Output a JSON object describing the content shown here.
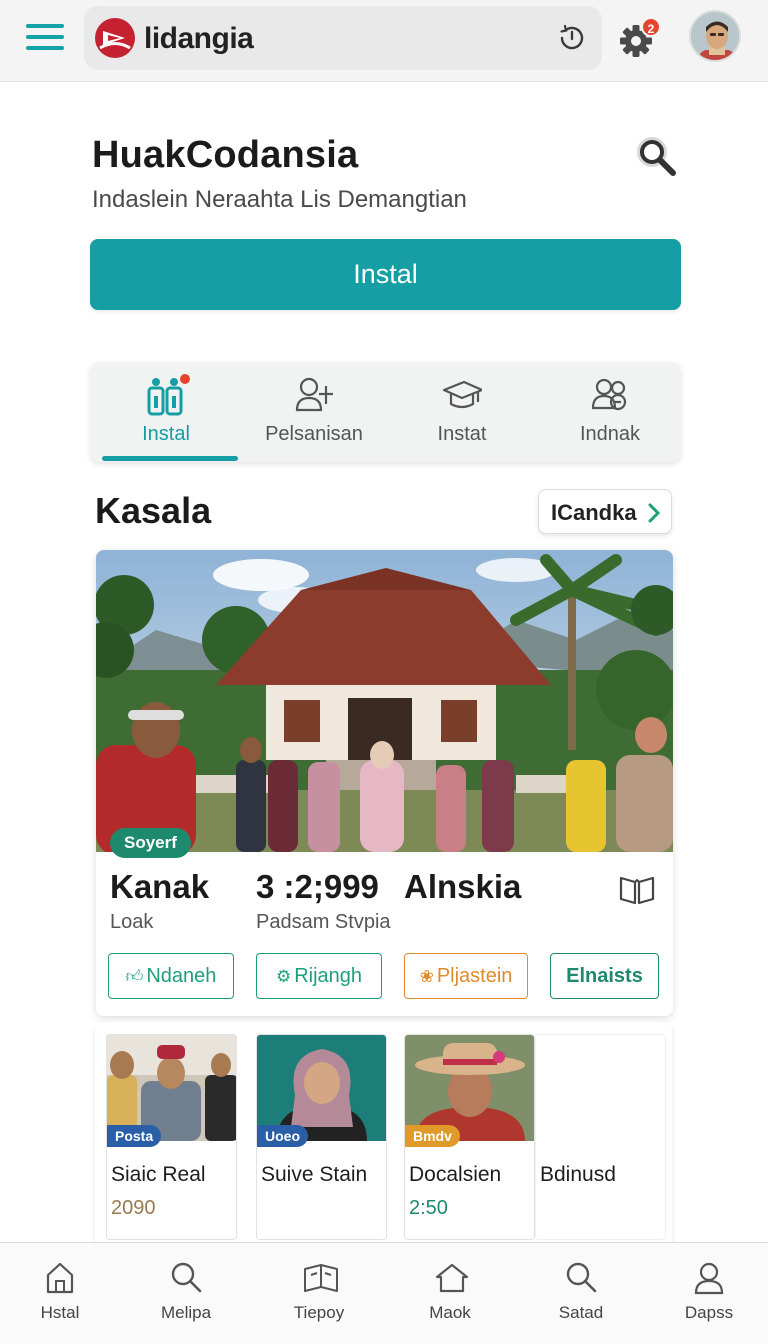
{
  "app": {
    "brand_name": "lidangia",
    "notification_count": "2",
    "accent_color": "#159ea4"
  },
  "hero": {
    "title": "HuakCodansia",
    "subtitle": "Indaslein Neraahta Lis Demangtian",
    "primary_button": "Instal"
  },
  "tabs": [
    {
      "label": "Instal",
      "icon": "clipboard-people-icon",
      "active": true
    },
    {
      "label": "Pelsanisan",
      "icon": "person-add-icon",
      "active": false
    },
    {
      "label": "Instat",
      "icon": "graduation-cap-icon",
      "active": false
    },
    {
      "label": "Indnak",
      "icon": "people-group-icon",
      "active": false
    }
  ],
  "section": {
    "title": "Kasala",
    "see_all": "ICandka"
  },
  "feature": {
    "photo_tag": "Soyerf",
    "stats": [
      {
        "value": "Kanak",
        "label": "Loak"
      },
      {
        "value": "3 :2;999",
        "label": "Padsam Stvpia"
      },
      {
        "value": "Alnskia",
        "label": ""
      }
    ],
    "actions": [
      {
        "label": "Ndaneh",
        "icon": "thumbs-up-icon",
        "color": "#1d9f7a"
      },
      {
        "label": "Rijangh",
        "icon": "badge-icon",
        "color": "#1d9f7a"
      },
      {
        "label": "Pljastein",
        "icon": "flower-icon",
        "color": "#e08a2c"
      },
      {
        "label": "Elnaists",
        "icon": "",
        "color": "#1d8a6e"
      }
    ]
  },
  "cards": [
    {
      "tag": "Posta",
      "tag_color": "#2a5fa8",
      "title": "Siaic Real",
      "meta": "2090",
      "meta_color": "#9a7a50"
    },
    {
      "tag": "Uoeo",
      "tag_color": "#2a5fa8",
      "title": "Suive Stain",
      "meta": "",
      "meta_color": "#555555"
    },
    {
      "tag": "Bmdv",
      "tag_color": "#e09a2a",
      "title": "Docalsien",
      "meta": "2:50",
      "meta_color": "#1d8a6e"
    },
    {
      "tag": "",
      "tag_color": "",
      "title": "Bdinusd",
      "meta": "",
      "meta_color": "#555555"
    }
  ],
  "bottom_nav": [
    {
      "label": "Hstal",
      "icon": "home-icon"
    },
    {
      "label": "Melipa",
      "icon": "search-icon"
    },
    {
      "label": "Tiepoy",
      "icon": "book-open-icon"
    },
    {
      "label": "Maok",
      "icon": "house-outline-icon"
    },
    {
      "label": "Satad",
      "icon": "search-icon"
    },
    {
      "label": "Dapss",
      "icon": "profile-icon"
    }
  ]
}
